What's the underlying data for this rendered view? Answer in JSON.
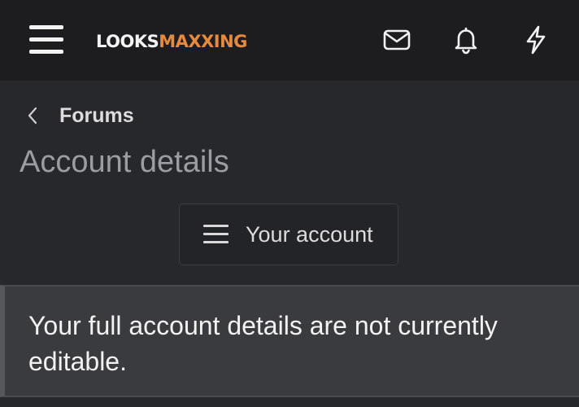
{
  "header": {
    "logo_part1": "LOOKS",
    "logo_part2": "MAXXING",
    "logo_colors": {
      "primary": "#f4f4f4",
      "accent": "#e68a3e"
    },
    "icons": [
      "menu-icon",
      "mail-icon",
      "bell-icon",
      "bolt-icon"
    ]
  },
  "breadcrumb": {
    "label": "Forums",
    "icon": "chevron-left-icon"
  },
  "page": {
    "title": "Account details"
  },
  "account_menu": {
    "label": "Your account",
    "icon": "menu-icon"
  },
  "notice": {
    "text": "Your full account details are not currently editable."
  },
  "colors": {
    "header_bg": "#1d1d1f",
    "page_bg": "#27282b",
    "notice_bg": "#3a3b3e",
    "title_color": "#9a9da1"
  }
}
